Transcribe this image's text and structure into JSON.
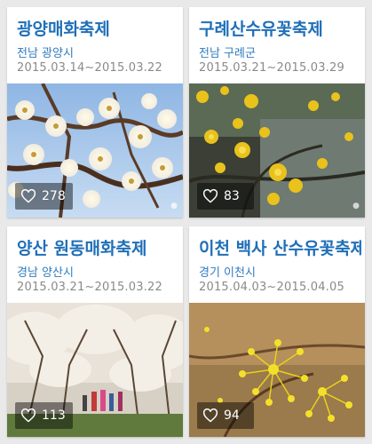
{
  "festivals": [
    {
      "title": "광양매화축제",
      "region": "전남 광양시",
      "dates": "2015.03.14~2015.03.22",
      "likes": "278",
      "photo_icon": "white-plum-blossom-photo"
    },
    {
      "title": "구례산수유꽃축제",
      "region": "전남 구례군",
      "dates": "2015.03.21~2015.03.29",
      "likes": "83",
      "photo_icon": "yellow-cornus-blossom-photo"
    },
    {
      "title": "양산 원동매화축제",
      "region": "경남 양산시",
      "dates": "2015.03.21~2015.03.22",
      "likes": "113",
      "photo_icon": "plum-orchard-visitors-photo"
    },
    {
      "title": "이천 백사 산수유꽃축제",
      "region": "경기 이천시",
      "dates": "2015.04.03~2015.04.05",
      "likes": "94",
      "photo_icon": "yellow-cornus-closeup-photo"
    }
  ],
  "colors": {
    "title": "#1f6fb8",
    "region": "#2f7bbf",
    "dates": "#8a8a8a",
    "background": "#e9e9e9"
  }
}
